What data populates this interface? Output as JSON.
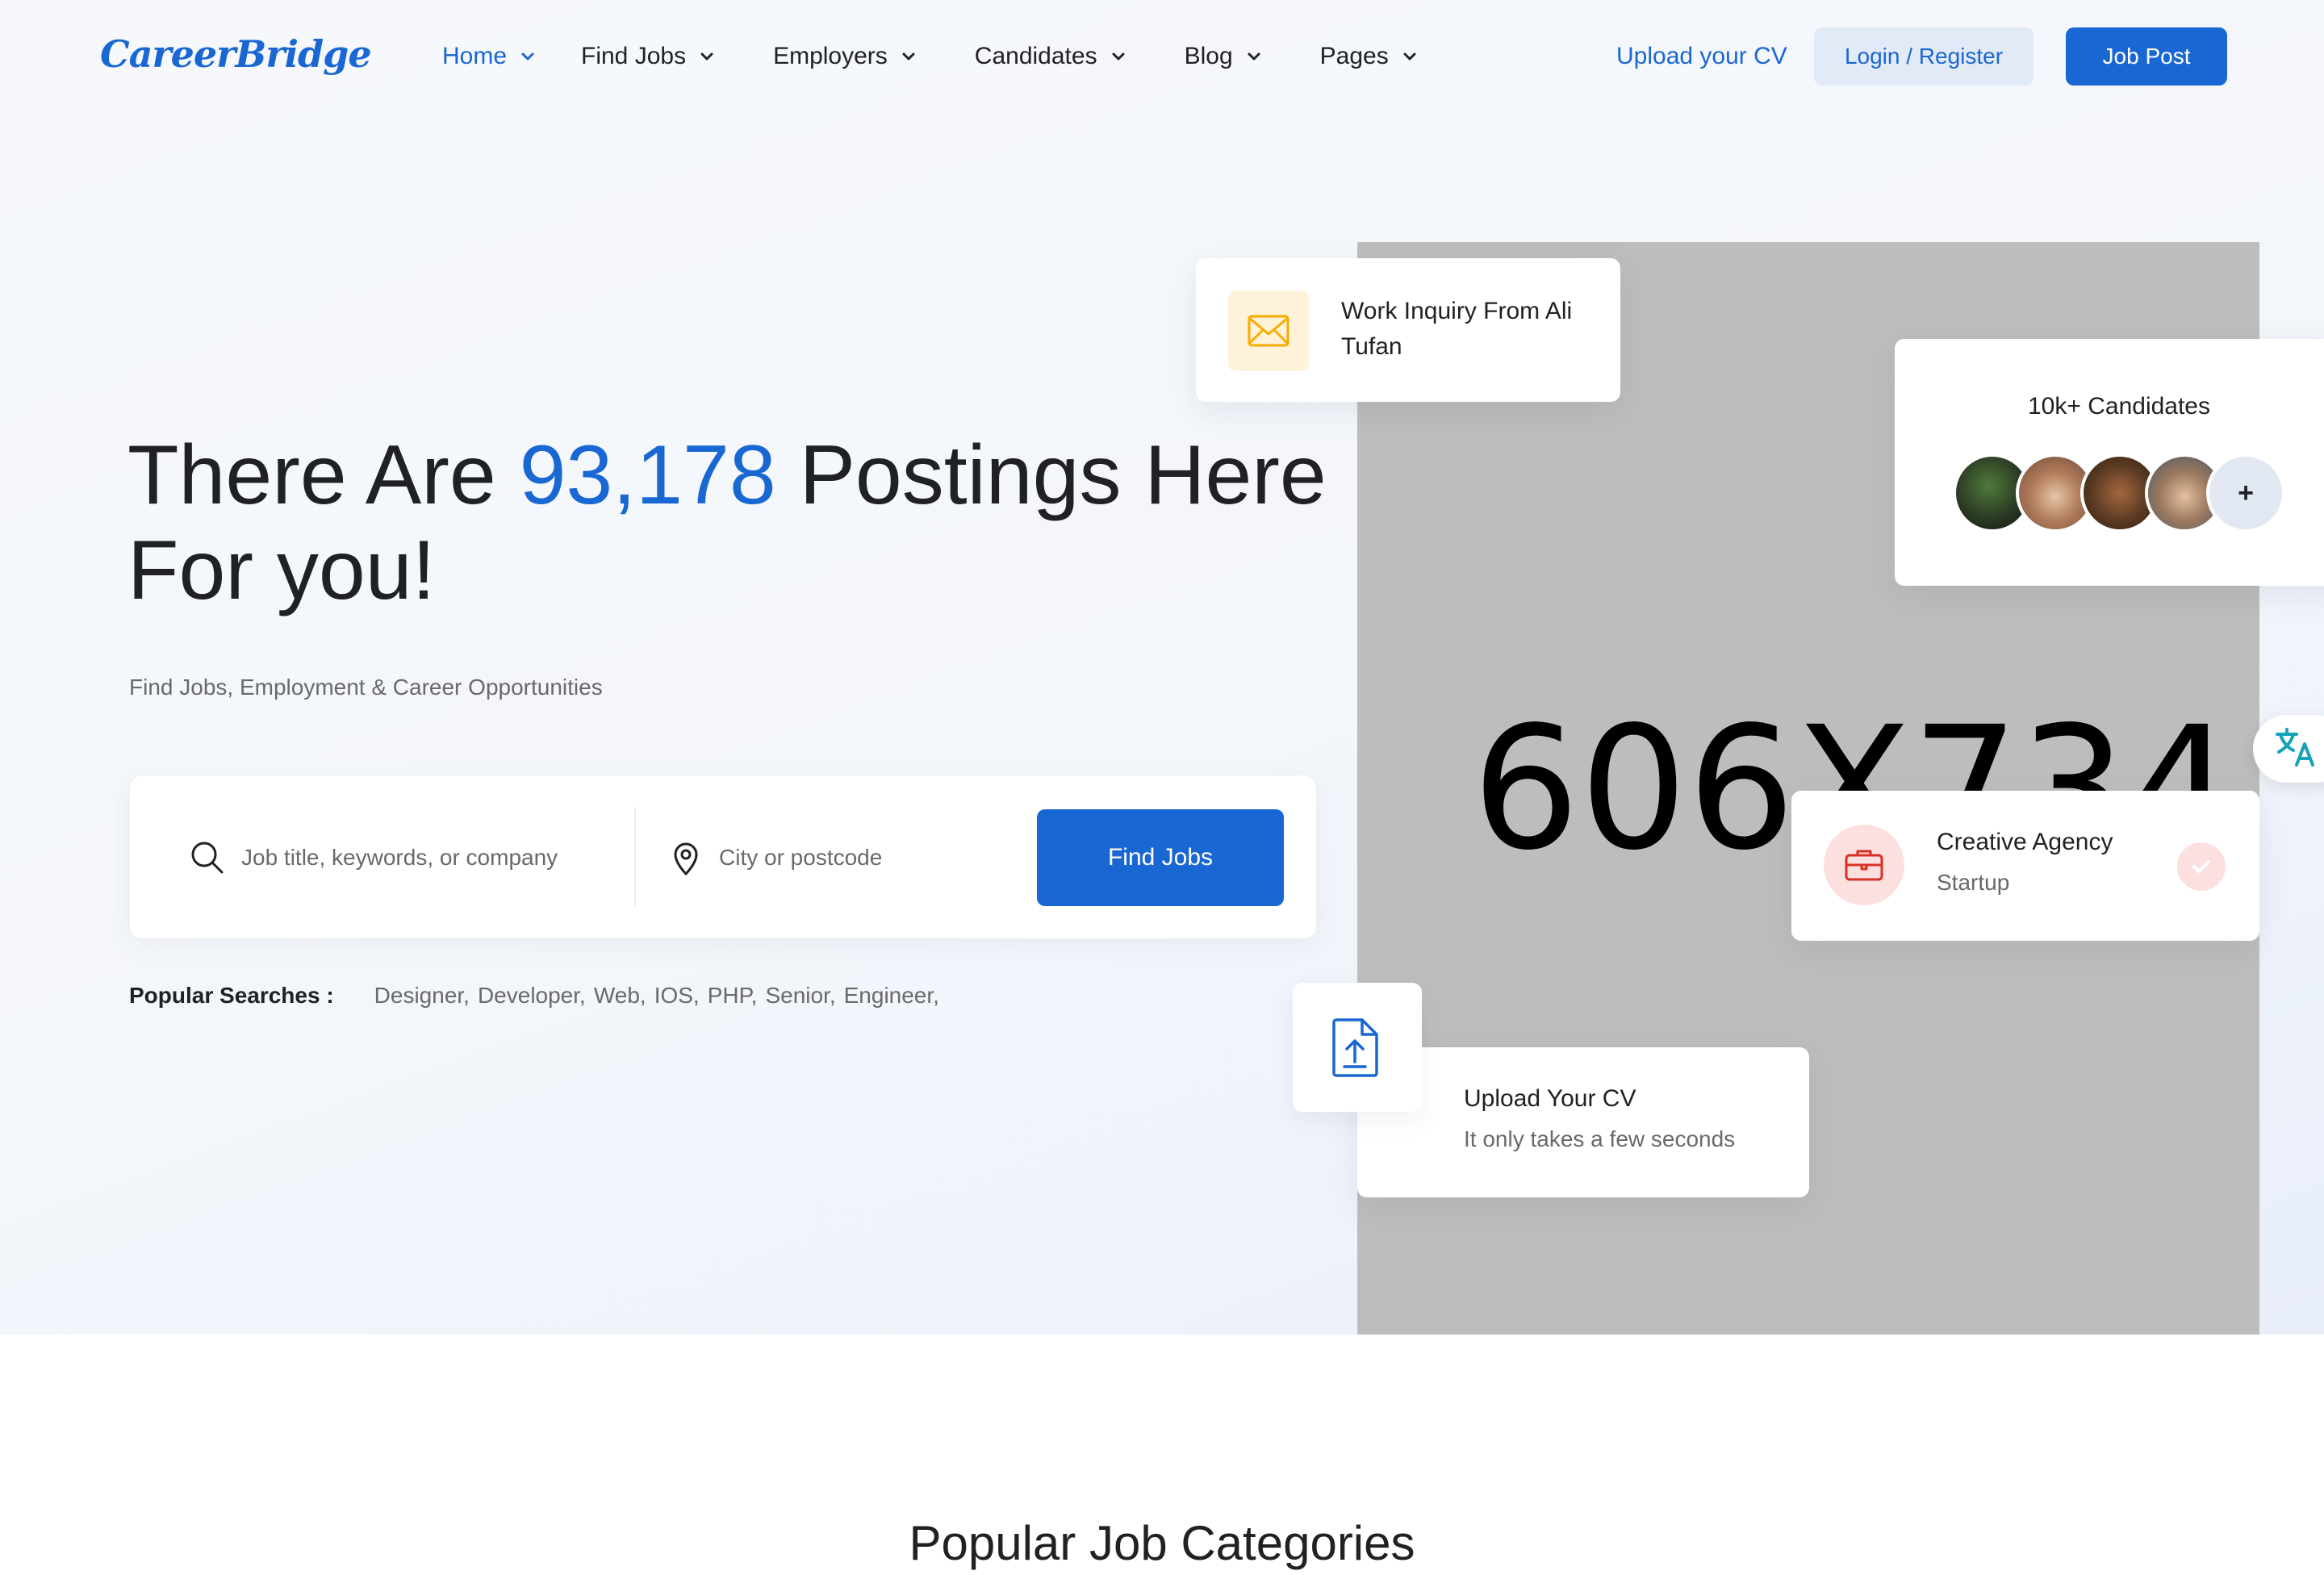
{
  "header": {
    "logo": "CareerBridge",
    "nav": [
      {
        "label": "Home"
      },
      {
        "label": "Find Jobs"
      },
      {
        "label": "Employers"
      },
      {
        "label": "Candidates"
      },
      {
        "label": "Blog"
      },
      {
        "label": "Pages"
      }
    ],
    "upload_cv": "Upload your CV",
    "login": "Login / Register",
    "job_post": "Job Post"
  },
  "hero": {
    "headline_before": "There Are ",
    "headline_number": "93,178",
    "headline_after": " Postings Here For you!",
    "subtitle": "Find Jobs, Employment & Career Opportunities",
    "search": {
      "keyword_placeholder": "Job title, keywords, or company",
      "location_placeholder": "City or postcode",
      "button": "Find Jobs"
    },
    "popular_label": "Popular Searches :",
    "popular_tags": [
      "Designer,",
      "Developer,",
      "Web,",
      "IOS,",
      "PHP,",
      "Senior,",
      "Engineer,"
    ]
  },
  "image_placeholder": "606X734",
  "cards": {
    "inquiry": {
      "title": "Work Inquiry From Ali Tufan",
      "icon": "envelope-icon"
    },
    "candidates": {
      "title": "10k+ Candidates",
      "more": "+"
    },
    "agency": {
      "title": "Creative Agency",
      "subtitle": "Startup",
      "icon": "briefcase-icon"
    },
    "upload": {
      "title": "Upload Your CV",
      "subtitle": "It only takes a few seconds",
      "icon": "file-upload-icon"
    }
  },
  "section": {
    "title": "Popular Job Categories"
  },
  "colors": {
    "accent": "#1967d2",
    "text": "#202124",
    "muted": "#696969",
    "amber": "#f9ab00",
    "red": "#d93025"
  }
}
